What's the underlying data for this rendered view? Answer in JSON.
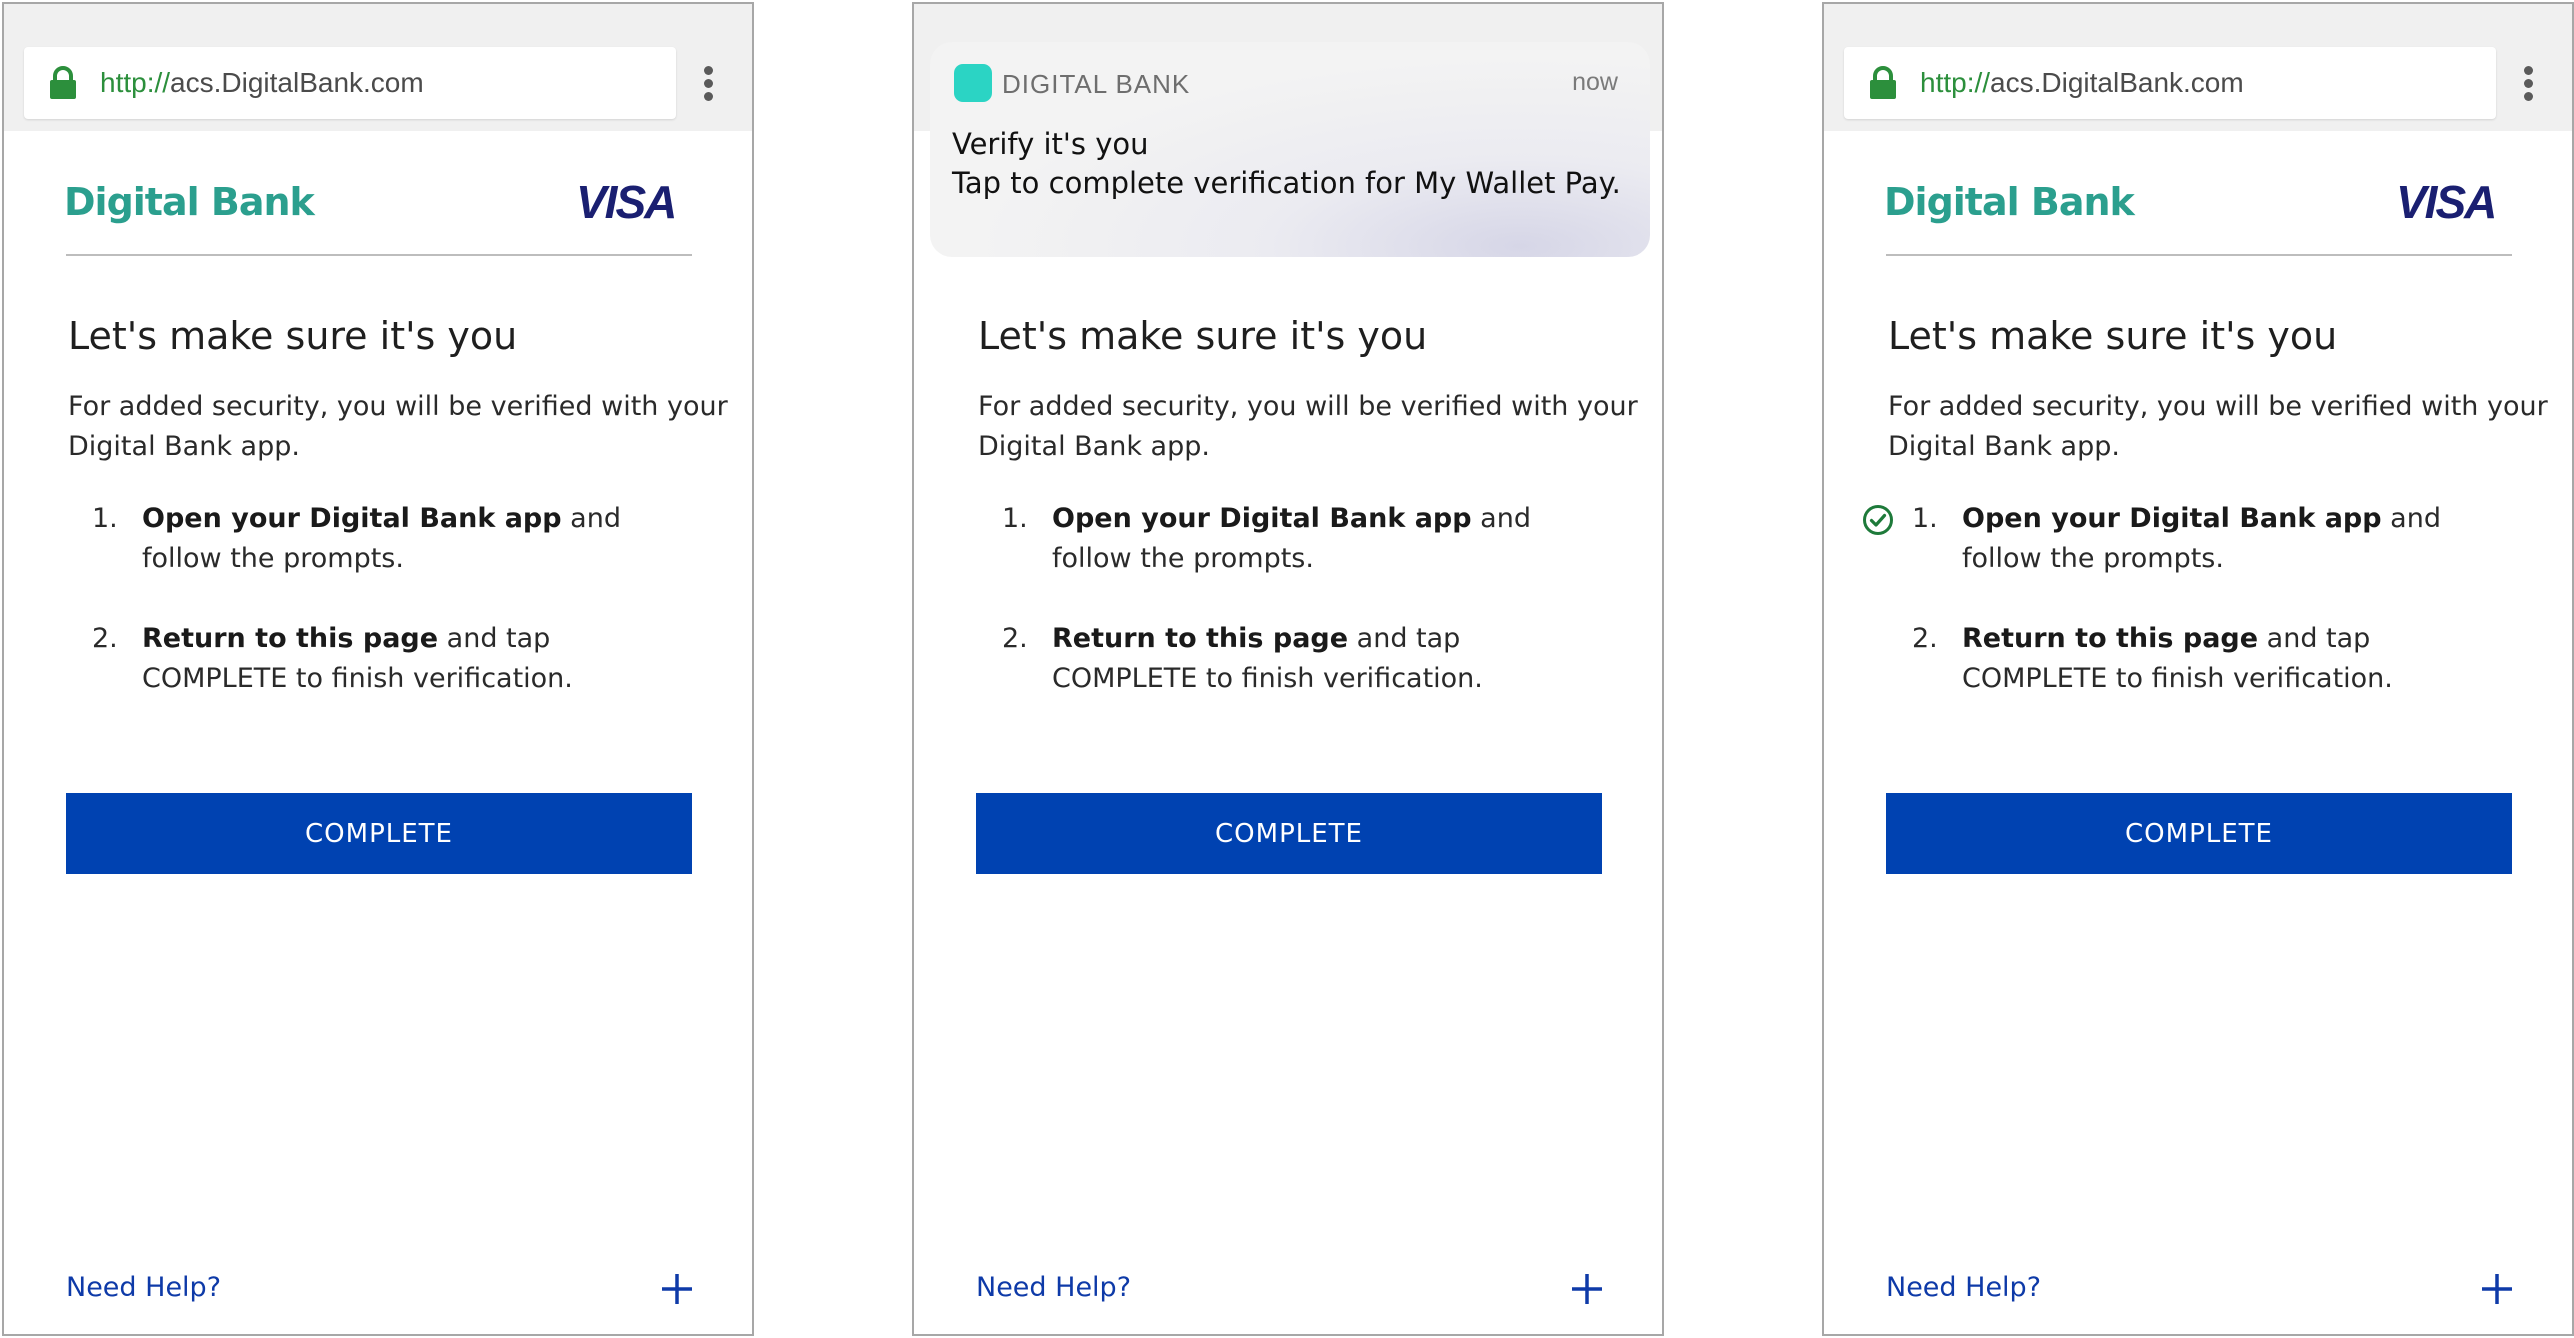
{
  "screens": [
    {
      "browser": {
        "url_scheme": "http://",
        "url_host": "acs.DigitalBank.com"
      },
      "header": {
        "bank_name": "Digital Bank",
        "card_brand": "VISA"
      },
      "content": {
        "title": "Let's make sure it's you",
        "intro": "For added security, you will be verified with your Digital Bank app.",
        "steps": [
          {
            "number": "1.",
            "bold": "Open your Digital Bank app",
            "rest": " and follow the prompts.",
            "completed": false
          },
          {
            "number": "2.",
            "bold": "Return to this page",
            "rest": " and tap COMPLETE to finish verification.",
            "completed": false
          }
        ],
        "button_label": "COMPLETE",
        "help_label": "Need Help?"
      }
    },
    {
      "notification": {
        "app_name": "DIGITAL BANK",
        "time": "now",
        "title": "Verify it's you",
        "body": "Tap to complete verification for My Wallet Pay."
      },
      "content": {
        "title": "Let's make sure it's you",
        "intro": "For added security, you will be verified with your Digital Bank app.",
        "steps": [
          {
            "number": "1.",
            "bold": "Open your Digital Bank app",
            "rest": " and follow the prompts.",
            "completed": false
          },
          {
            "number": "2.",
            "bold": "Return to this page",
            "rest": " and tap COMPLETE to finish verification.",
            "completed": false
          }
        ],
        "button_label": "COMPLETE",
        "help_label": "Need Help?"
      }
    },
    {
      "browser": {
        "url_scheme": "http://",
        "url_host": "acs.DigitalBank.com"
      },
      "header": {
        "bank_name": "Digital Bank",
        "card_brand": "VISA"
      },
      "content": {
        "title": "Let's make sure it's you",
        "intro": "For added security, you will be verified with your Digital Bank app.",
        "steps": [
          {
            "number": "1.",
            "bold": "Open your Digital Bank app",
            "rest": " and follow the prompts.",
            "completed": true
          },
          {
            "number": "2.",
            "bold": "Return to this page",
            "rest": " and tap COMPLETE to finish verification.",
            "completed": false
          }
        ],
        "button_label": "COMPLETE",
        "help_label": "Need Help?"
      }
    }
  ],
  "colors": {
    "brand_teal": "#2b9f8e",
    "visa_navy": "#1a1f71",
    "button_blue": "#0042b1",
    "link_blue": "#0e3aa8",
    "lock_green": "#2c8f3c",
    "check_green": "#1e7a3a",
    "notification_icon": "#2bd4c4"
  },
  "icons": [
    "lock-icon",
    "menu-dots-icon",
    "app-icon",
    "checkmark-icon",
    "plus-icon"
  ]
}
